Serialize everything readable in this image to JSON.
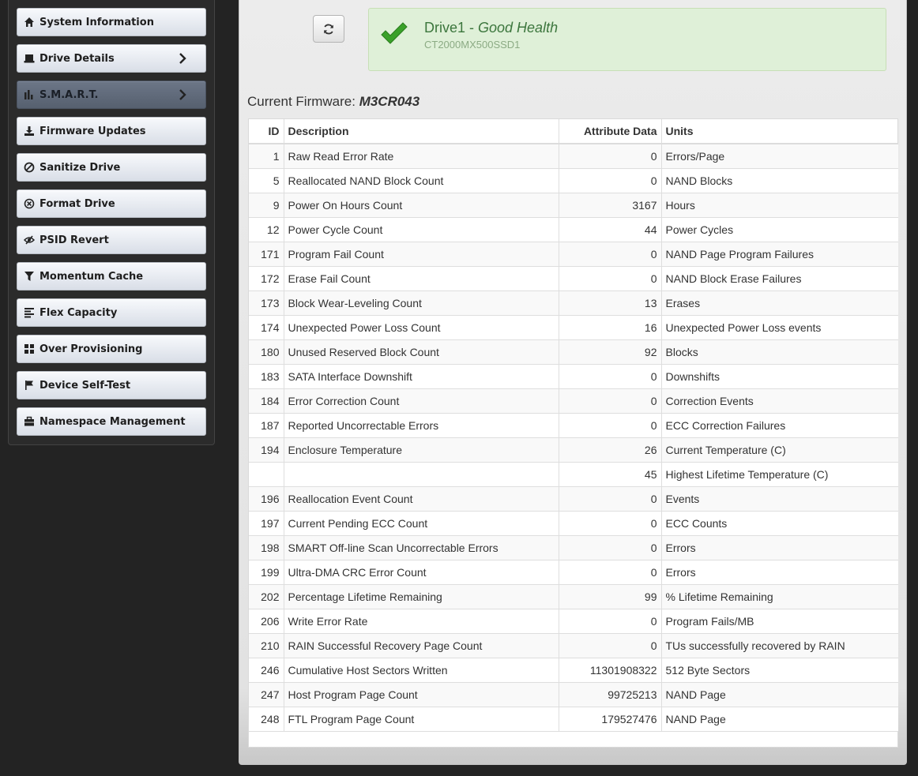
{
  "sidebar": {
    "items": [
      {
        "label": "System Information",
        "icon": "home-icon",
        "has_chevron": false,
        "active": false
      },
      {
        "label": "Drive Details",
        "icon": "drive-icon",
        "has_chevron": true,
        "active": false
      },
      {
        "label": "S.M.A.R.T.",
        "icon": "bar-chart-icon",
        "has_chevron": true,
        "active": true
      },
      {
        "label": "Firmware Updates",
        "icon": "download-icon",
        "has_chevron": false,
        "active": false
      },
      {
        "label": "Sanitize Drive",
        "icon": "ban-icon",
        "has_chevron": false,
        "active": false
      },
      {
        "label": "Format Drive",
        "icon": "circle-x-icon",
        "has_chevron": false,
        "active": false
      },
      {
        "label": "PSID Revert",
        "icon": "eye-slash-icon",
        "has_chevron": false,
        "active": false
      },
      {
        "label": "Momentum Cache",
        "icon": "filter-icon",
        "has_chevron": false,
        "active": false
      },
      {
        "label": "Flex Capacity",
        "icon": "align-left-icon",
        "has_chevron": false,
        "active": false
      },
      {
        "label": "Over Provisioning",
        "icon": "grid-icon",
        "has_chevron": false,
        "active": false
      },
      {
        "label": "Device Self-Test",
        "icon": "flag-icon",
        "has_chevron": false,
        "active": false
      },
      {
        "label": "Namespace Management",
        "icon": "briefcase-icon",
        "has_chevron": false,
        "active": false
      }
    ]
  },
  "health": {
    "drive_name": "Drive1",
    "separator": " - ",
    "status": "Good Health",
    "model": "CT2000MX500SSD1",
    "status_color": "#3c763d"
  },
  "firmware": {
    "label": "Current Firmware: ",
    "version": "M3CR043"
  },
  "table": {
    "headers": {
      "id": "ID",
      "description": "Description",
      "data": "Attribute Data",
      "units": "Units"
    },
    "rows": [
      {
        "id": "1",
        "description": "Raw Read Error Rate",
        "data": "0",
        "units": "Errors/Page"
      },
      {
        "id": "5",
        "description": "Reallocated NAND Block Count",
        "data": "0",
        "units": "NAND Blocks"
      },
      {
        "id": "9",
        "description": "Power On Hours Count",
        "data": "3167",
        "units": "Hours"
      },
      {
        "id": "12",
        "description": "Power Cycle Count",
        "data": "44",
        "units": "Power Cycles"
      },
      {
        "id": "171",
        "description": "Program Fail Count",
        "data": "0",
        "units": "NAND Page Program Failures"
      },
      {
        "id": "172",
        "description": "Erase Fail Count",
        "data": "0",
        "units": "NAND Block Erase Failures"
      },
      {
        "id": "173",
        "description": "Block Wear-Leveling Count",
        "data": "13",
        "units": "Erases"
      },
      {
        "id": "174",
        "description": "Unexpected Power Loss Count",
        "data": "16",
        "units": "Unexpected Power Loss events"
      },
      {
        "id": "180",
        "description": "Unused Reserved Block Count",
        "data": "92",
        "units": "Blocks"
      },
      {
        "id": "183",
        "description": "SATA Interface Downshift",
        "data": "0",
        "units": "Downshifts"
      },
      {
        "id": "184",
        "description": "Error Correction Count",
        "data": "0",
        "units": "Correction Events"
      },
      {
        "id": "187",
        "description": "Reported Uncorrectable Errors",
        "data": "0",
        "units": "ECC Correction Failures"
      },
      {
        "id": "194",
        "description": "Enclosure Temperature",
        "data": "26",
        "units": "Current Temperature (C)"
      },
      {
        "id": "",
        "description": "",
        "data": "45",
        "units": "Highest Lifetime Temperature (C)"
      },
      {
        "id": "196",
        "description": "Reallocation Event Count",
        "data": "0",
        "units": "Events"
      },
      {
        "id": "197",
        "description": "Current Pending ECC Count",
        "data": "0",
        "units": "ECC Counts"
      },
      {
        "id": "198",
        "description": "SMART Off-line Scan Uncorrectable Errors",
        "data": "0",
        "units": "Errors"
      },
      {
        "id": "199",
        "description": "Ultra-DMA CRC Error Count",
        "data": "0",
        "units": "Errors"
      },
      {
        "id": "202",
        "description": "Percentage Lifetime Remaining",
        "data": "99",
        "units": "% Lifetime Remaining"
      },
      {
        "id": "206",
        "description": "Write Error Rate",
        "data": "0",
        "units": "Program Fails/MB"
      },
      {
        "id": "210",
        "description": "RAIN Successful Recovery Page Count",
        "data": "0",
        "units": "TUs successfully recovered by RAIN"
      },
      {
        "id": "246",
        "description": "Cumulative Host Sectors Written",
        "data": "11301908322",
        "units": "512 Byte Sectors"
      },
      {
        "id": "247",
        "description": "Host Program Page Count",
        "data": "99725213",
        "units": "NAND Page"
      },
      {
        "id": "248",
        "description": "FTL Program Page Count",
        "data": "179527476",
        "units": "NAND Page"
      }
    ]
  },
  "toolbar": {
    "refresh_icon": "refresh-icon"
  }
}
